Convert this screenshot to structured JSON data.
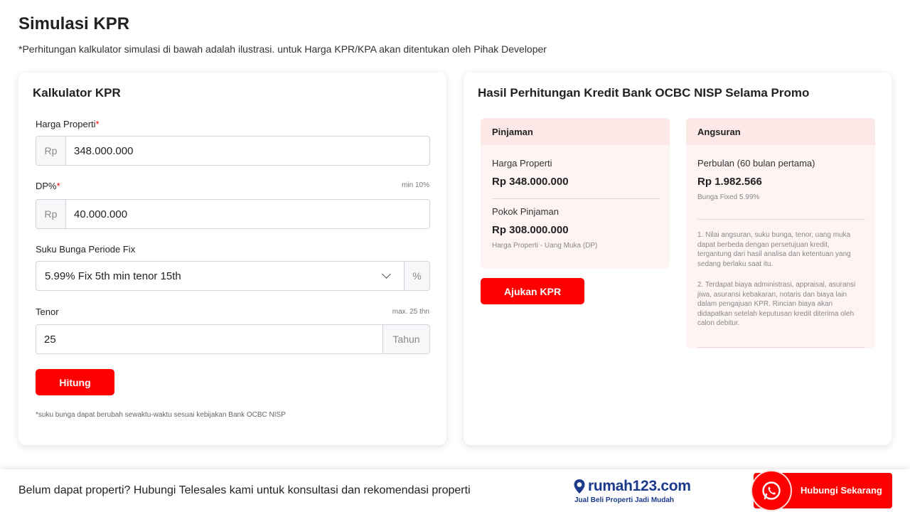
{
  "page": {
    "title": "Simulasi KPR",
    "subtitle": "*Perhitungan kalkulator simulasi di bawah adalah ilustrasi. untuk Harga KPR/KPA akan ditentukan oleh Pihak Developer"
  },
  "calculator": {
    "title": "Kalkulator KPR",
    "harga": {
      "label": "Harga Properti",
      "required_mark": "*",
      "prefix": "Rp",
      "value": "348.000.000"
    },
    "dp": {
      "label": "DP%",
      "required_mark": "*",
      "hint": "min 10%",
      "prefix": "Rp",
      "value": "40.000.000"
    },
    "bunga": {
      "label": "Suku Bunga Periode Fix",
      "selected": "5.99% Fix 5th min tenor 15th",
      "suffix": "%"
    },
    "tenor": {
      "label": "Tenor",
      "hint": "max. 25 thn",
      "value": "25",
      "suffix": "Tahun"
    },
    "button": "Hitung",
    "note": "*suku bunga dapat berubah sewaktu-waktu sesuai kebijakan Bank OCBC NISP"
  },
  "result": {
    "title": "Hasil Perhitungan Kredit Bank OCBC NISP Selama Promo",
    "pinjaman": {
      "header": "Pinjaman",
      "harga_label": "Harga Properti",
      "harga_value": "Rp 348.000.000",
      "pokok_label": "Pokok Pinjaman",
      "pokok_value": "Rp 308.000.000",
      "pokok_note": "Harga Properti - Uang Muka (DP)"
    },
    "angsuran": {
      "header": "Angsuran",
      "perbulan_label": "Perbulan (60 bulan pertama)",
      "perbulan_value": "Rp 1.982.566",
      "bunga_note": "Bunga Fixed 5.99%",
      "note1": "1. Nilai angsuran, suku bunga, tenor, uang muka dapat berbeda dengan persetujuan kredit, tergantung dari hasil analisa dan ketentuan yang sedang berlaku saat itu.",
      "note2": "2. Terdapat biaya administrasi, appraisal, asuransi jiwa, asuransi kebakaran, notaris dan biaya lain dalam pengajuan KPR. Rincian biaya akan didapatkan setelah keputusan kredit diterima oleh calon debitur."
    },
    "button": "Ajukan KPR"
  },
  "footer": {
    "text": "Belum dapat properti? Hubungi Telesales kami untuk konsultasi dan rekomendasi properti",
    "logo_text": "rumah123.com",
    "logo_tagline": "Jual Beli Properti Jadi Mudah",
    "cta": "Hubungi Sekarang"
  },
  "colors": {
    "accent": "#fe0000",
    "brand_blue": "#1b3a8a",
    "panel_bg": "#fef4f4",
    "panel_head": "#fde8e8"
  },
  "icons": {
    "whatsapp": "whatsapp-icon",
    "location": "location-pin-icon",
    "dropdown": "chevron-down-icon"
  }
}
